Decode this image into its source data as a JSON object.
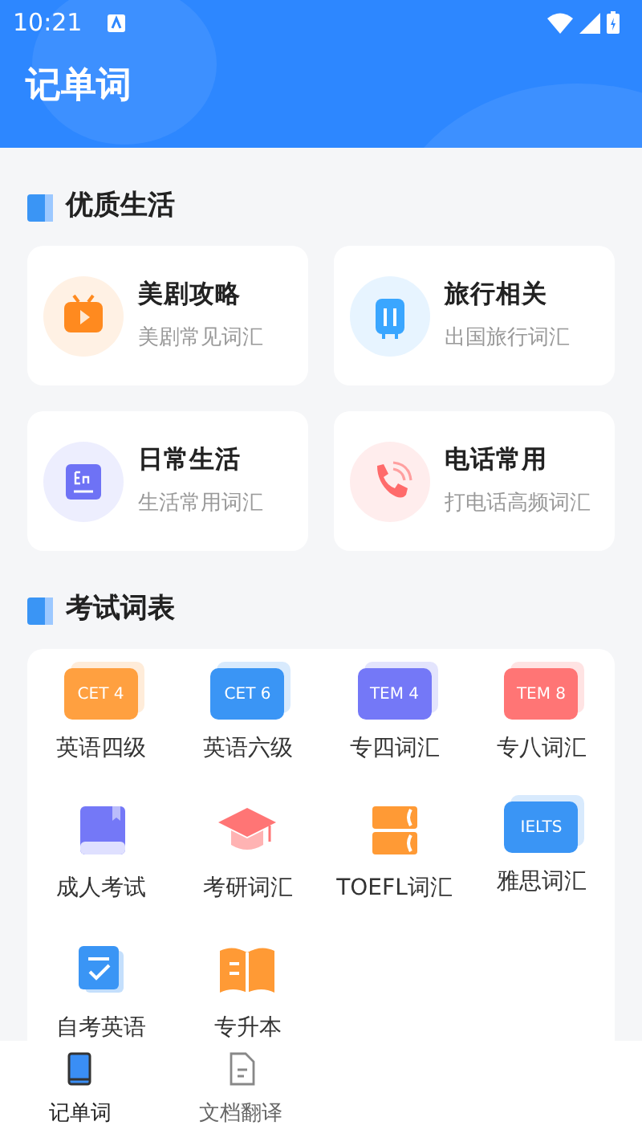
{
  "status_bar": {
    "time": "10:21"
  },
  "header": {
    "title": "记单词"
  },
  "sections": [
    {
      "title": "优质生活",
      "kind": "cards",
      "items": [
        {
          "title": "美剧攻略",
          "subtitle": "美剧常见词汇"
        },
        {
          "title": "旅行相关",
          "subtitle": "出国旅行词汇"
        },
        {
          "title": "日常生活",
          "subtitle": "生活常用词汇"
        },
        {
          "title": "电话常用",
          "subtitle": "打电话高频词汇"
        }
      ]
    },
    {
      "title": "考试词表",
      "kind": "grid",
      "items": [
        {
          "label": "英语四级",
          "kind": "badge",
          "badge": "CET 4"
        },
        {
          "label": "英语六级",
          "kind": "badge",
          "badge": "CET 6"
        },
        {
          "label": "专四词汇",
          "kind": "badge",
          "badge": "TEM 4"
        },
        {
          "label": "专八词汇",
          "kind": "badge",
          "badge": "TEM 8"
        },
        {
          "label": "成人考试",
          "kind": "icon"
        },
        {
          "label": "考研词汇",
          "kind": "icon"
        },
        {
          "label": "TOEFL词汇",
          "kind": "icon"
        },
        {
          "label": "雅思词汇",
          "kind": "badge",
          "badge": "IELTS"
        },
        {
          "label": "自考英语",
          "kind": "icon"
        },
        {
          "label": "专升本",
          "kind": "icon"
        }
      ]
    }
  ],
  "bottom_nav": [
    {
      "label": "记单词",
      "selected": true
    },
    {
      "label": "文档翻译",
      "selected": false
    }
  ]
}
